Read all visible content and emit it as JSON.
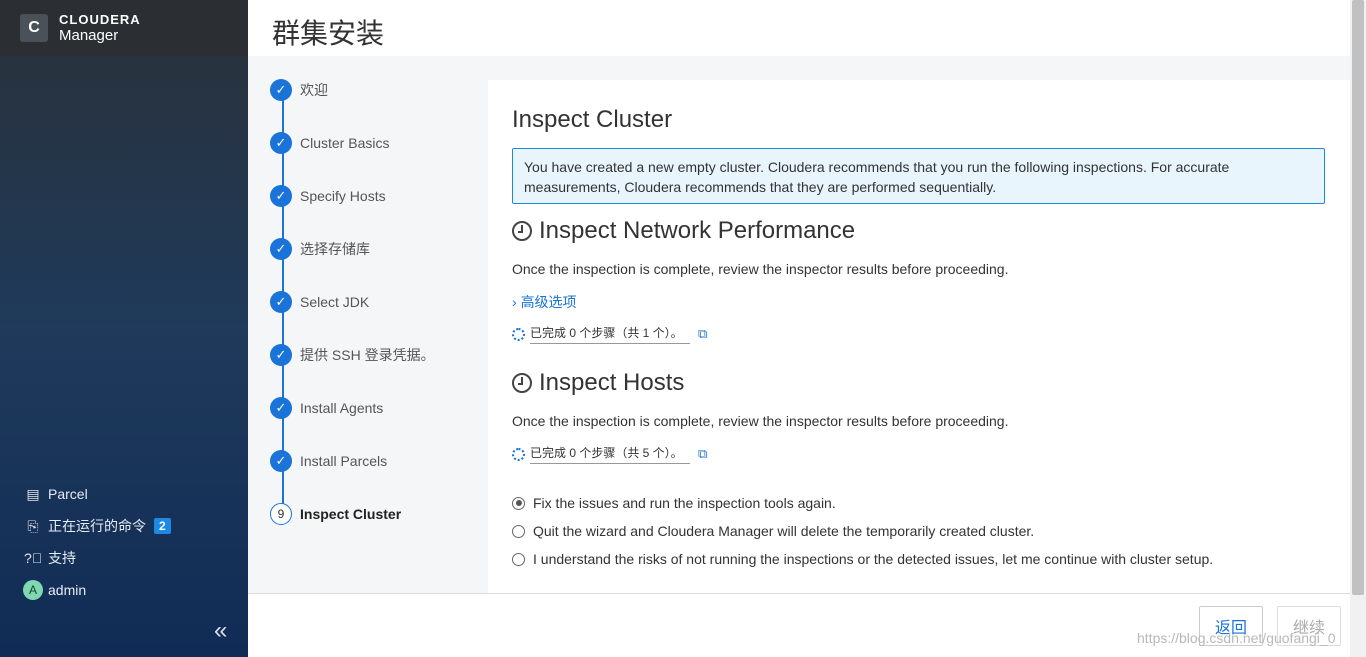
{
  "brand": {
    "name": "CLOUDERA",
    "sub": "Manager",
    "logo_glyph": "C"
  },
  "header": {
    "title": "群集安装"
  },
  "sidebar": {
    "items": [
      {
        "label": "Parcel",
        "icon": "gift-icon"
      },
      {
        "label": "正在运行的命令",
        "icon": "running-commands-icon",
        "badge": "2"
      },
      {
        "label": "支持",
        "icon": "help-icon"
      },
      {
        "label": "admin",
        "icon": "avatar",
        "avatar_letter": "A"
      }
    ],
    "collapse": "«"
  },
  "steps": [
    {
      "label": "欢迎",
      "done": true
    },
    {
      "label": "Cluster Basics",
      "done": true
    },
    {
      "label": "Specify Hosts",
      "done": true
    },
    {
      "label": "选择存储库",
      "done": true
    },
    {
      "label": "Select JDK",
      "done": true
    },
    {
      "label": "提供 SSH 登录凭据。",
      "done": true
    },
    {
      "label": "Install Agents",
      "done": true
    },
    {
      "label": "Install Parcels",
      "done": true
    },
    {
      "label": "Inspect Cluster",
      "done": false,
      "number": "9",
      "active": true
    }
  ],
  "main": {
    "title": "Inspect Cluster",
    "alert": "You have created a new empty cluster. Cloudera recommends that you run the following inspections. For accurate measurements, Cloudera recommends that they are performed sequentially.",
    "network": {
      "title": "Inspect Network Performance",
      "desc": "Once the inspection is complete, review the inspector results before proceeding.",
      "advanced": "高级选项",
      "status": "已完成 0 个步骤（共 1 个）。"
    },
    "hosts": {
      "title": "Inspect Hosts",
      "desc": "Once the inspection is complete, review the inspector results before proceeding.",
      "status": "已完成 0 个步骤（共 5 个）。"
    },
    "options": [
      {
        "label": "Fix the issues and run the inspection tools again.",
        "checked": true
      },
      {
        "label": "Quit the wizard and Cloudera Manager will delete the temporarily created cluster.",
        "checked": false
      },
      {
        "label": "I understand the risks of not running the inspections or the detected issues, let me continue with cluster setup.",
        "checked": false
      }
    ]
  },
  "footer": {
    "back": "返回",
    "next": "继续",
    "watermark": "https://blog.csdn.net/guofangi_0"
  },
  "colors": {
    "accent": "#1a73d9",
    "sidebar_top": "#2a3139",
    "sidebar_bottom": "#102c56",
    "alert_bg": "#e8f5fd"
  }
}
